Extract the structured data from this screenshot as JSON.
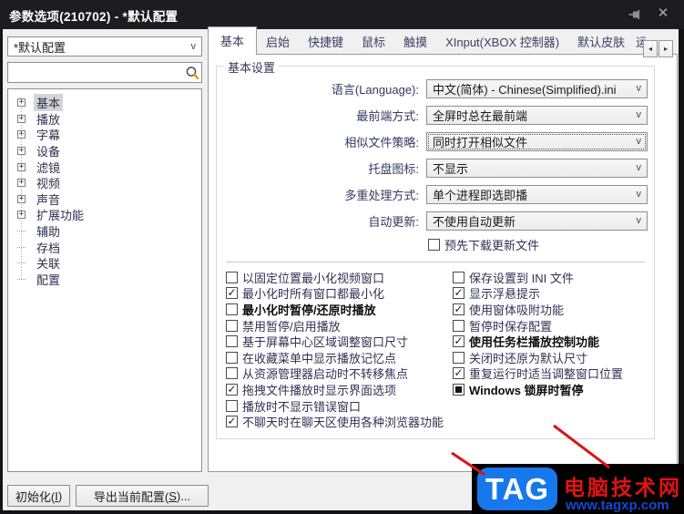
{
  "window": {
    "title": "参数选项(210702) - *默认配置"
  },
  "icons": {
    "pin-icon": "pushpin",
    "close-icon": "✕",
    "search-icon": "magnifier",
    "chevron-down-icon": "v",
    "expand-icon": "+",
    "check-icon": "✓",
    "scroll-left-icon": "◂",
    "scroll-right-icon": "▸"
  },
  "sidebar": {
    "profile_dropdown": {
      "value": "*默认配置"
    },
    "search": {
      "value": ""
    },
    "tree": [
      {
        "label": "基本",
        "expandable": true,
        "selected": true
      },
      {
        "label": "播放",
        "expandable": true
      },
      {
        "label": "字幕",
        "expandable": true
      },
      {
        "label": "设备",
        "expandable": true
      },
      {
        "label": "滤镜",
        "expandable": true
      },
      {
        "label": "视频",
        "expandable": true
      },
      {
        "label": "声音",
        "expandable": true
      },
      {
        "label": "扩展功能",
        "expandable": true
      },
      {
        "label": "辅助",
        "expandable": false
      },
      {
        "label": "存档",
        "expandable": false
      },
      {
        "label": "关联",
        "expandable": false
      },
      {
        "label": "配置",
        "expandable": false
      }
    ]
  },
  "tabs": {
    "items": [
      {
        "label": "基本",
        "selected": true
      },
      {
        "label": "启始"
      },
      {
        "label": "快捷键"
      },
      {
        "label": "鼠标"
      },
      {
        "label": "触摸"
      },
      {
        "label": "XInput(XBOX 控制器)"
      },
      {
        "label": "默认皮肤"
      },
      {
        "label": "运",
        "partial": true
      }
    ]
  },
  "panel": {
    "group_title": "基本设置",
    "fields": [
      {
        "label": "语言(Language):",
        "value": "中文(简体) - Chinese(Simplified).ini"
      },
      {
        "label": "最前端方式:",
        "value": "全屏时总在最前端"
      },
      {
        "label": "相似文件策略:",
        "value": "同时打开相似文件",
        "focused": true
      },
      {
        "label": "托盘图标:",
        "value": "不显示"
      },
      {
        "label": "多重处理方式:",
        "value": "单个进程即选即播"
      },
      {
        "label": "自动更新:",
        "value": "不使用自动更新"
      }
    ],
    "update_checkbox": {
      "label": "预先下载更新文件",
      "state": "unchecked"
    },
    "checkboxes_left": [
      {
        "label": "以固定位置最小化视频窗口",
        "state": "unchecked"
      },
      {
        "label": "最小化时所有窗口都最小化",
        "state": "checked"
      },
      {
        "label": "最小化时暂停/还原时播放",
        "state": "unchecked",
        "bold": true
      },
      {
        "label": "禁用暂停/启用播放",
        "state": "unchecked"
      },
      {
        "label": "基于屏幕中心区域调整窗口尺寸",
        "state": "unchecked"
      },
      {
        "label": "在收藏菜单中显示播放记忆点",
        "state": "unchecked"
      },
      {
        "label": "从资源管理器启动时不转移焦点",
        "state": "unchecked"
      },
      {
        "label": "拖拽文件播放时显示界面选项",
        "state": "checked"
      },
      {
        "label": "播放时不显示错误窗口",
        "state": "unchecked"
      },
      {
        "label": "不聊天时在聊天区使用各种浏览器功能",
        "state": "checked"
      }
    ],
    "checkboxes_right": [
      {
        "label": "保存设置到 INI 文件",
        "state": "unchecked"
      },
      {
        "label": "显示浮悬提示",
        "state": "checked"
      },
      {
        "label": "使用窗体吸附功能",
        "state": "checked"
      },
      {
        "label": "暂停时保存配置",
        "state": "unchecked"
      },
      {
        "label": "使用任务栏播放控制功能",
        "state": "checked",
        "bold": true
      },
      {
        "label": "关闭时还原为默认尺寸",
        "state": "unchecked"
      },
      {
        "label": "重复运行时适当调整窗口位置",
        "state": "checked"
      },
      {
        "label": "Windows 锁屏时暂停",
        "state": "indeterminate",
        "bold": true
      }
    ]
  },
  "footer": {
    "initialize_button": {
      "pre": "初始化(",
      "key": "I",
      "post": ")"
    },
    "export_button": {
      "pre": "导出当前配置(",
      "key": "S",
      "post": ")..."
    }
  },
  "watermark": {
    "logo": "TAG",
    "site_name": "电脑技术网",
    "site_url": "www.tagxp.com",
    "logo_bg": "#1678ea",
    "name_color": "#e31212",
    "url_color": "#1747cf",
    "annotation_color": "#da1414"
  }
}
